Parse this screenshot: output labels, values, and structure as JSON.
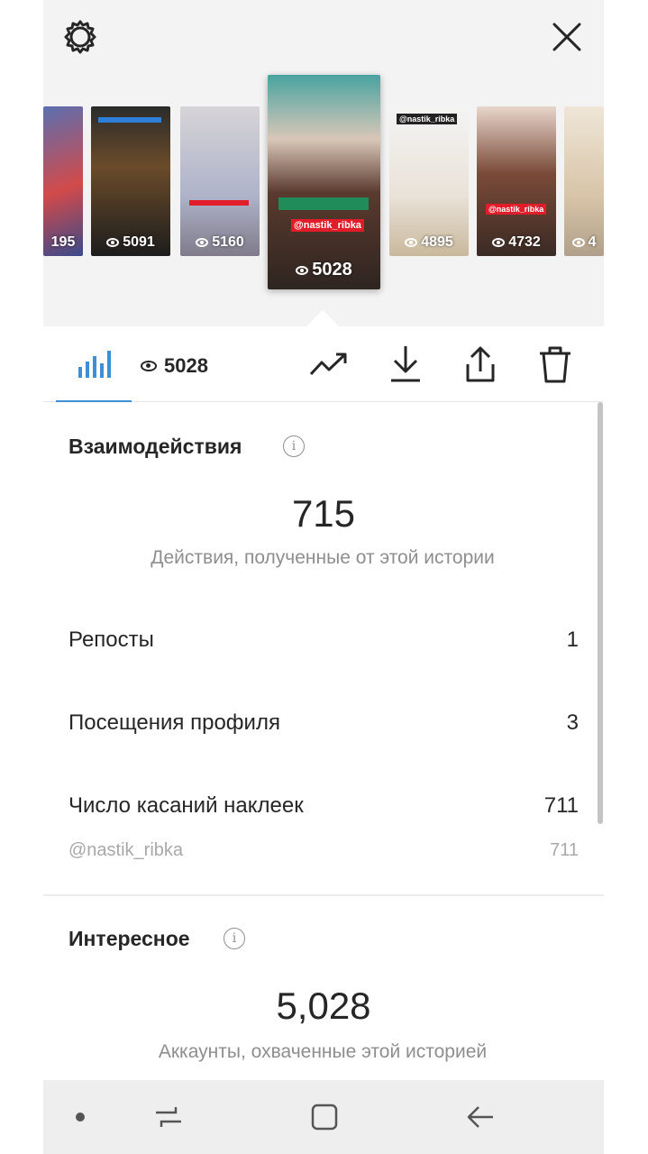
{
  "stories": [
    {
      "views": "195"
    },
    {
      "views": "5091"
    },
    {
      "views": "5160"
    },
    {
      "views": "5028",
      "sticker": "@nastik_ribka"
    },
    {
      "views": "4895",
      "sticker": "@nastik_ribka"
    },
    {
      "views": "4732",
      "sticker": "@nastik_ribka"
    },
    {
      "views": "4"
    }
  ],
  "toolbar": {
    "views": "5028"
  },
  "interactions": {
    "title": "Взаимодействия",
    "info": "i",
    "total": "715",
    "caption": "Действия, полученные от этой истории",
    "rows": [
      {
        "label": "Репосты",
        "value": "1"
      },
      {
        "label": "Посещения профиля",
        "value": "3"
      },
      {
        "label": "Число касаний наклеек",
        "value": "711"
      }
    ],
    "sub_row": {
      "label": "@nastik_ribka",
      "value": "711"
    }
  },
  "discovery": {
    "title": "Интересное",
    "info": "i",
    "total": "5,028",
    "caption": "Аккаунты, охваченные этой историей"
  },
  "colors": {
    "accent": "#3f8fd6",
    "text": "#262626",
    "muted": "#8e8e8e",
    "sticker": "#e11d2a"
  }
}
